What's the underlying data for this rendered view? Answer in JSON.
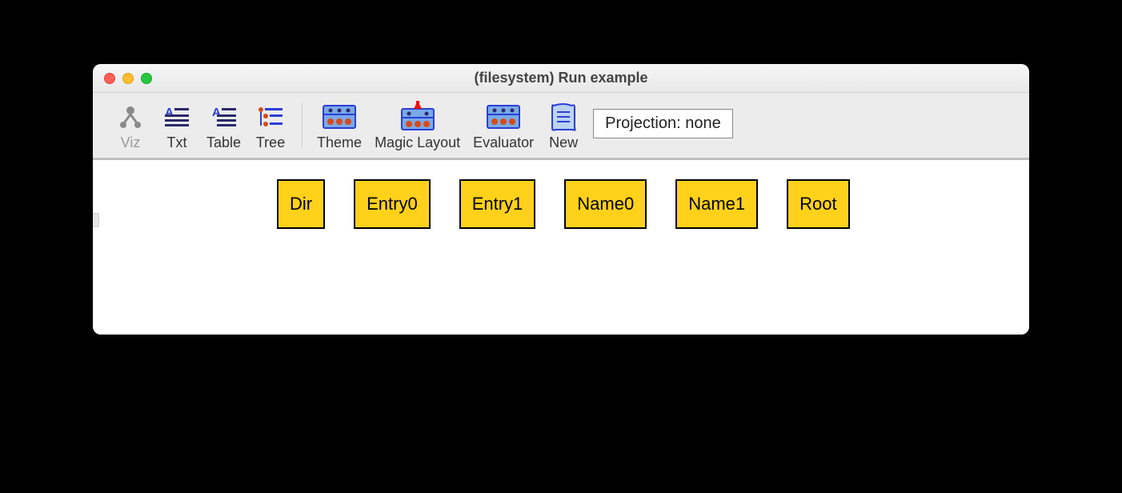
{
  "window": {
    "title": "(filesystem) Run example"
  },
  "toolbar": {
    "viz_label": "Viz",
    "txt_label": "Txt",
    "table_label": "Table",
    "tree_label": "Tree",
    "theme_label": "Theme",
    "magic_layout_label": "Magic Layout",
    "evaluator_label": "Evaluator",
    "new_label": "New",
    "projection_label": "Projection: none"
  },
  "nodes": {
    "n0": "Dir",
    "n1": "Entry0",
    "n2": "Entry1",
    "n3": "Name0",
    "n4": "Name1",
    "n5": "Root"
  }
}
